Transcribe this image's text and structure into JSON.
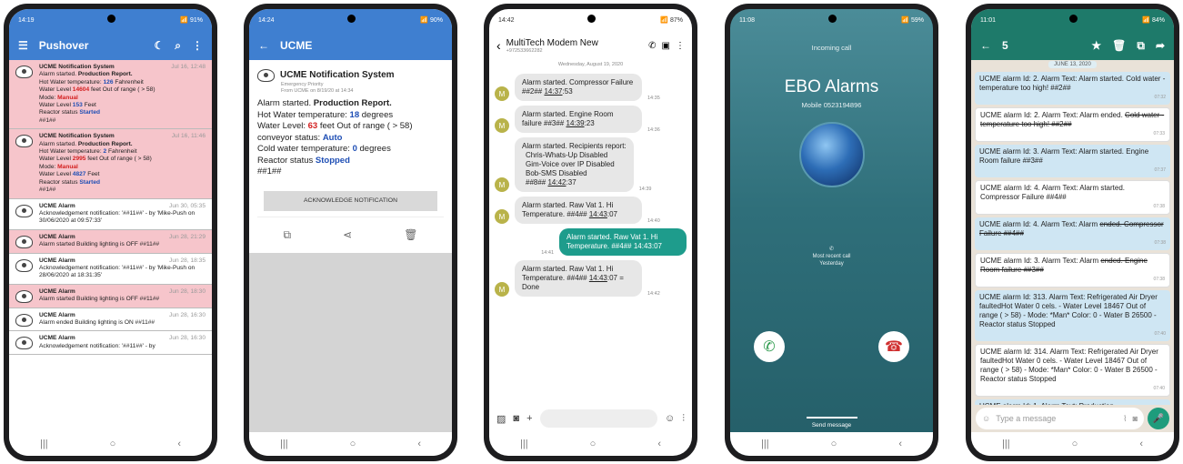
{
  "nav": [
    "|||",
    "○",
    "‹"
  ],
  "p1": {
    "time": "14:19",
    "battery": "91%",
    "title": "Pushover",
    "items": [
      {
        "red": true,
        "title": "UCME Notification System",
        "time": "Jul 16, 12:48",
        "l1": "Alarm started.",
        "l1b": "Production Report.",
        "l2a": "Hot Water temperature:",
        "l2b": "126",
        "l2c": "Fahrenheit",
        "l3a": "Water Level",
        "l3b": "14604",
        "l3c": "feet Out of range ( > 58)",
        "l4a": "Mode:",
        "l4b": "Manual",
        "l5a": "Water Level",
        "l5b": "153",
        "l5c": "Feet",
        "l6a": "Reactor status",
        "l6b": "Started",
        "l7": "##1##"
      },
      {
        "red": true,
        "title": "UCME Notification System",
        "time": "Jul 16, 11:46",
        "l1": "Alarm started.",
        "l1b": "Production Report.",
        "l2a": "Hot Water temperature:",
        "l2b": "2",
        "l2c": "Fahrenheit",
        "l3a": "Water Level",
        "l3b": "2995",
        "l3c": "feet Out of range ( > 58)",
        "l4a": "Mode:",
        "l4b": "Manual",
        "l5a": "Water Level",
        "l5b": "4827",
        "l5c": "Feet",
        "l6a": "Reactor status",
        "l6b": "Started",
        "l7": "##1##"
      }
    ],
    "simple": [
      {
        "red": false,
        "title": "UCME Alarm",
        "time": "Jun 30, 05:35",
        "text": "Acknowledgement notification: '##11##' - by 'Mike-Push on 30/06/2020 at 09:57:33'"
      },
      {
        "red": true,
        "title": "UCME Alarm",
        "time": "Jun 28, 21:29",
        "text": "Alarm started Building lighting is OFF ##11##"
      },
      {
        "red": false,
        "title": "UCME Alarm",
        "time": "Jun 28, 18:35",
        "text": "Acknowledgement notification: '##11##' - by 'Mike-Push on 28/06/2020 at 18:31:35'"
      },
      {
        "red": true,
        "title": "UCME Alarm",
        "time": "Jun 28, 18:30",
        "text": "Alarm started Building lighting is OFF ##11##"
      },
      {
        "red": false,
        "title": "UCME Alarm",
        "time": "Jun 28, 16:30",
        "text": "Alarm ended Building lighting is ON ##11##"
      },
      {
        "red": false,
        "title": "UCME Alarm",
        "time": "Jun 28, 16:30",
        "text": "Acknowledgement notification: '##11##' - by"
      }
    ]
  },
  "p2": {
    "time": "14:24",
    "battery": "90%",
    "title": "UCME",
    "app": "UCME Notification System",
    "sub1": "Emergency Priority",
    "sub2": "From UCME on 8/19/20 at 14:34",
    "l1": "Alarm started.",
    "l1b": "Production Report.",
    "l2a": "Hot Water temperature:",
    "l2b": "18",
    "l2c": "degrees",
    "l3a": "Water Level:",
    "l3b": "63",
    "l3c": "feet Out of range ( > 58)",
    "l4a": "conveyor status:",
    "l4b": "Auto",
    "l5a": "Cold water temperature:",
    "l5b": "0",
    "l5c": "degrees",
    "l6a": "Reactor status",
    "l6b": "Stopped",
    "l7": "##1##",
    "button": "ACKNOWLEDGE NOTIFICATION"
  },
  "p3": {
    "time": "14:42",
    "battery": "87%",
    "contact": "MultiTech Modem New",
    "number": "+972533662282",
    "date": "Wednesday, August 19, 2020",
    "avatar": "M",
    "m1a": "Alarm started. Compressor Failure ##2##",
    "m1b": "14:37",
    "m1c": ":53",
    "m1t": "14:35",
    "m2a": "Alarm started. Engine Room failure ##3##",
    "m2b": "14:39",
    "m2c": ":23",
    "m2t": "14:36",
    "m3a": "Alarm started. Recipients report:",
    "m3b": "Chris-Whats-Up Disabled",
    "m3c": "Gim-Voice over IP Disabled",
    "m3d": "Bob-SMS Disabled",
    "m3e": "##8##",
    "m3f": "14:42",
    "m3g": ":37",
    "m3t": "14:39",
    "m4a": "Alarm started. Raw Vat 1. Hi Temperature. ##4##",
    "m4b": "14:43",
    "m4c": ":07",
    "m4t": "14:40",
    "m5a": "Alarm started. Raw Vat 1. Hi Temperature. ##4## 14:43:07",
    "m5t": "14:41",
    "m6a": "Alarm started. Raw Vat 1. Hi Temperature. ##4##",
    "m6b": "14:43",
    "m6c": ":07 = Done",
    "m6t": "14:42"
  },
  "p4": {
    "time": "11:08",
    "battery": "59%",
    "incoming": "Incoming call",
    "name": "EBO Alarms",
    "mobile": "Mobile 0523194896",
    "recent": "Most recent call",
    "yesterday": "Yesterday",
    "send": "Send message"
  },
  "p5": {
    "time": "11:01",
    "battery": "84%",
    "count": "5",
    "date": "JUNE 13, 2020",
    "input": "Type a message",
    "msgs": [
      {
        "bg": "b",
        "a": "UCME alarm Id: 2. Alarm Text: Alarm started. Cold water - temperature too high! ##2##",
        "t": "07:32"
      },
      {
        "bg": "w",
        "a": "UCME alarm Id: 2. Alarm Text: Alarm ended.",
        "s": "Cold water - temperature too high! ##2##",
        "t": "07:33"
      },
      {
        "bg": "b",
        "a": "UCME alarm Id: 3. Alarm Text: Alarm started. Engine Room failure ##3##",
        "t": "07:37"
      },
      {
        "bg": "w",
        "a": "UCME alarm Id: 4. Alarm Text: Alarm started. Compressor Failure ##4##",
        "t": "07:38"
      },
      {
        "bg": "b",
        "a": "UCME alarm Id: 4. Alarm Text: Alarm",
        "s": "ended. Compressor Failure ##4##",
        "t": "07:38"
      },
      {
        "bg": "w",
        "a": "UCME alarm Id: 3. Alarm Text: Alarm",
        "s": "ended. Engine Room failure ##3##",
        "t": "07:38"
      },
      {
        "bg": "b",
        "a": "UCME alarm Id: 313. Alarm Text: Refrigerated Air Dryer faultedHot Water 0 cels. - Water Level 18467 Out of range ( > 58) - Mode: *Man* Color: 0 - Water B 26500 - Reactor status Stopped",
        "t": "07:40"
      },
      {
        "bg": "w",
        "a": "UCME alarm Id: 314. Alarm Text: Refrigerated Air Dryer faultedHot Water 0 cels. - Water Level 18467 Out of range ( > 58) - Mode: *Man* Color: 0 - Water B 26500 - Reactor status Stopped",
        "t": "07:40"
      },
      {
        "bg": "b",
        "a": "UCME alarm Id: 1. Alarm Text: Production",
        "t": ""
      }
    ]
  }
}
